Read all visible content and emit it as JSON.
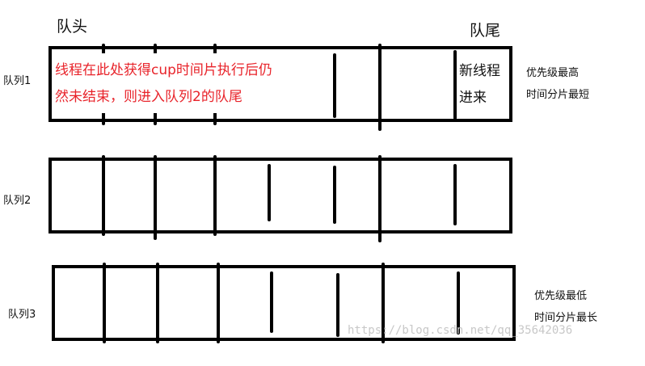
{
  "labels": {
    "head": "队头",
    "tail": "队尾",
    "queue1": "队列1",
    "queue2": "队列2",
    "queue3": "队列3"
  },
  "queue1_note": {
    "line1": "线程在此处获得cup时间片执行后仍",
    "line2": "然未结束，则进入队列2的队尾"
  },
  "new_thread": {
    "line1": "新线程",
    "line2": "进来"
  },
  "priority_high": {
    "line1": "优先级最高",
    "line2": "时间分片最短"
  },
  "priority_low": {
    "line1": "优先级最低",
    "line2": "时间分片最长"
  },
  "watermark": "https://blog.csdn.net/qq_35642036",
  "colors": {
    "stroke": "#000000",
    "note": "#e8232a",
    "text": "#111111"
  }
}
